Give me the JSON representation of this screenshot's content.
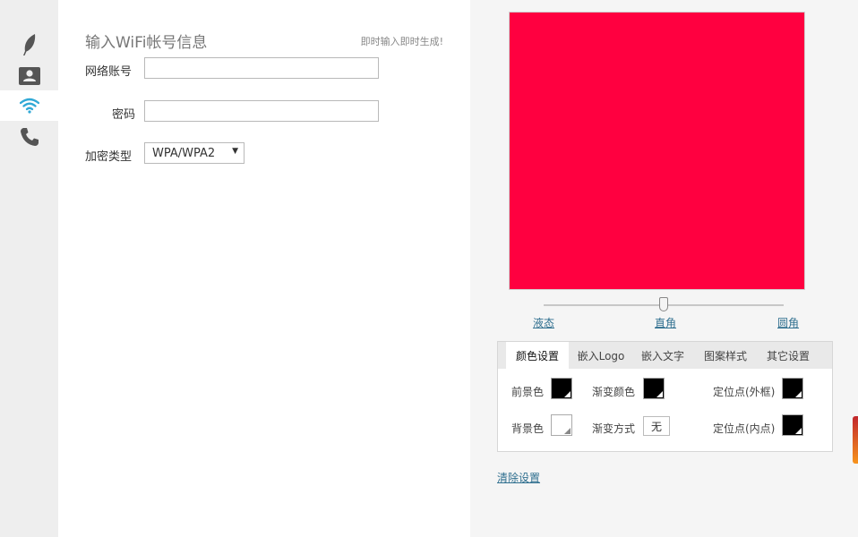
{
  "sidebar": {
    "items": [
      {
        "name": "text",
        "icon": "feather-icon"
      },
      {
        "name": "card",
        "icon": "contact-card-icon"
      },
      {
        "name": "wifi",
        "icon": "wifi-icon",
        "active": true
      },
      {
        "name": "phone",
        "icon": "phone-icon"
      }
    ],
    "active_color": "#31a9d6"
  },
  "form": {
    "title": "输入WiFi帐号信息",
    "hint": "即时输入即时生成!",
    "ssid_label": "网络账号",
    "ssid_value": "",
    "password_label": "密码",
    "password_value": "",
    "encryption_label": "加密类型",
    "encryption_value": "WPA/WPA2"
  },
  "preview": {
    "color": "#ff0040"
  },
  "slider": {
    "left_label": "液态",
    "middle_label": "直角",
    "right_label": "圆角",
    "selected": "直角"
  },
  "settings": {
    "tabs": [
      "颜色设置",
      "嵌入Logo",
      "嵌入文字",
      "图案样式",
      "其它设置"
    ],
    "active_tab": "颜色设置",
    "foreground_label": "前景色",
    "foreground_color": "#000000",
    "gradient_color_label": "渐变颜色",
    "gradient_color": "#000000",
    "finder_outer_label": "定位点(外框)",
    "finder_outer_color": "#000000",
    "background_label": "背景色",
    "background_color": "#ffffff",
    "gradient_mode_label": "渐变方式",
    "gradient_mode_value": "无",
    "finder_inner_label": "定位点(内点)",
    "finder_inner_color": "#000000"
  },
  "clear_label": "清除设置"
}
